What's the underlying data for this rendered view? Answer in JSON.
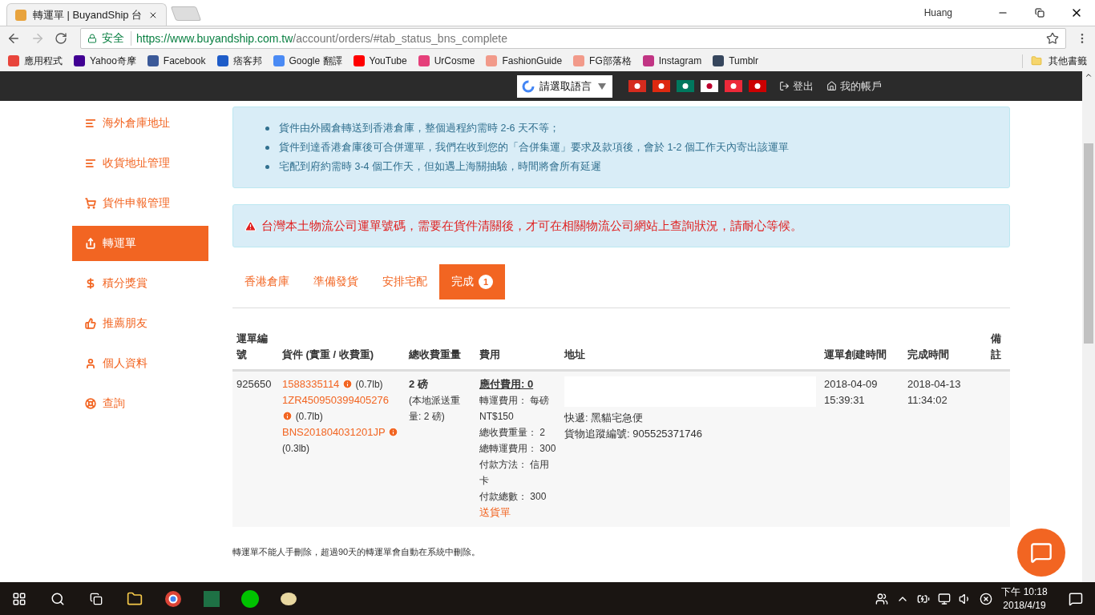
{
  "browser": {
    "tab_title": "轉運單 | BuyandShip 台",
    "profile": "Huang",
    "secure_label": "安全",
    "url_host": "https://www.buyandship.com.tw",
    "url_path": "/account/orders/#tab_status_bns_complete",
    "bookmarks": [
      {
        "label": "應用程式",
        "color": "#e8453c"
      },
      {
        "label": "Yahoo奇摩",
        "color": "#410093"
      },
      {
        "label": "Facebook",
        "color": "#3b5998"
      },
      {
        "label": "痞客邦",
        "color": "#1e5cc8"
      },
      {
        "label": "Google 翻譯",
        "color": "#4a8af4"
      },
      {
        "label": "YouTube",
        "color": "#ff0000"
      },
      {
        "label": "UrCosme",
        "color": "#e5407a"
      },
      {
        "label": "FashionGuide",
        "color": "#f29a8a"
      },
      {
        "label": "FG部落格",
        "color": "#f29a8a"
      },
      {
        "label": "Instagram",
        "color": "#c13584"
      },
      {
        "label": "Tumblr",
        "color": "#36465d"
      }
    ],
    "other_bookmarks": "其他書籤"
  },
  "topnav": {
    "language": "請選取語言",
    "logout": "登出",
    "account": "我的帳戶"
  },
  "sidebar": {
    "items": [
      {
        "label": "海外倉庫地址",
        "selected": false
      },
      {
        "label": "收貨地址管理",
        "selected": false
      },
      {
        "label": "貨件申報管理",
        "selected": false
      },
      {
        "label": "轉運單",
        "selected": true
      },
      {
        "label": "積分獎賞",
        "selected": false
      },
      {
        "label": "推薦朋友",
        "selected": false
      },
      {
        "label": "個人資料",
        "selected": false
      },
      {
        "label": "查詢",
        "selected": false
      }
    ]
  },
  "info_notes": [
    "貨件由外國倉轉送到香港倉庫，整個過程約需時 2-6 天不等；",
    "貨件到達香港倉庫後可合併運單，我們在收到您的「合併集運」要求及款項後，會於 1-2 個工作天內寄出該運單",
    "宅配到府約需時 3-4 個工作天，但如遇上海關抽驗，時間將會所有延遲"
  ],
  "warning": "台灣本土物流公司運單號碼，需要在貨件清關後，才可在相關物流公司網站上查詢狀況，請耐心等候。",
  "tabs": [
    {
      "label": "香港倉庫",
      "selected": false
    },
    {
      "label": "準備發貨",
      "selected": false
    },
    {
      "label": "安排宅配",
      "selected": false
    },
    {
      "label": "完成",
      "selected": true,
      "badge": "1"
    }
  ],
  "table": {
    "columns": [
      "運單編號",
      "貨件 (實重 / 收費重)",
      "總收費重量",
      "費用",
      "地址",
      "運單創建時間",
      "完成時間",
      "備註"
    ],
    "rows": [
      {
        "id": "925650",
        "items": [
          {
            "code": "1588335114",
            "weight": "(0.7lb)"
          },
          {
            "code": "1ZR450950399405276",
            "weight": "(0.7lb)"
          },
          {
            "code": "BNS201804031201JP",
            "weight": "(0.3lb)"
          }
        ],
        "total_weight": "2 磅",
        "local_weight": "(本地派送重量: 2 磅)",
        "fee_due": "應付費用: 0",
        "fee_lines": [
          "轉運費用： 每磅 NT$150",
          "總收費重量： 2",
          "總轉運費用： 300",
          "付款方法： 信用卡",
          "付款總數： 300"
        ],
        "delivery_note": "送貨單",
        "courier": "快遞: 黑貓宅急便",
        "tracking": "貨物追蹤編號: 905525371746",
        "created": "2018-04-09 15:39:31",
        "completed": "2018-04-13 11:34:02"
      }
    ]
  },
  "footer_note": "轉運單不能人手刪除，超過90天的轉運單會自動在系統中刪除。",
  "taskbar": {
    "time": "下午 10:18",
    "date": "2018/4/19"
  }
}
